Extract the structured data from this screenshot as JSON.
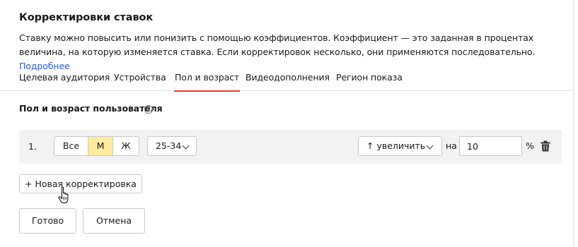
{
  "title": "Корректировки ставок",
  "description": {
    "text": "Ставку можно повысить или понизить с помощью коэффициентов. Коэффициент — это заданная в процентах величина, на которую изменяется ставка. Если корректировок несколько, они применяются последовательно.",
    "link": "Подробнее"
  },
  "tabs": [
    {
      "label": "Целевая аудитория"
    },
    {
      "label": "Устройства"
    },
    {
      "label": "Пол и возраст",
      "active": true
    },
    {
      "label": "Видеодополнения"
    },
    {
      "label": "Регион показа"
    }
  ],
  "section": {
    "label": "Пол и возраст пользователя",
    "help_icon": "question-circle-icon"
  },
  "adjustment": {
    "number": "1.",
    "gender_options": [
      "Все",
      "М",
      "Ж"
    ],
    "gender_selected": "М",
    "age_value": "25-34",
    "direction_value": "↑ увеличить",
    "preposition": "на",
    "percent_value": "10",
    "percent_sign": "%",
    "delete_icon": "trash-icon"
  },
  "buttons": {
    "new_adjustment": "+ Новая корректировка",
    "done": "Готово",
    "cancel": "Отмена"
  },
  "colors": {
    "link": "#2a5dd0",
    "active_tab_underline": "#e8382c",
    "selected_segment": "#ffeba0",
    "row_background": "#f2f2f2"
  }
}
